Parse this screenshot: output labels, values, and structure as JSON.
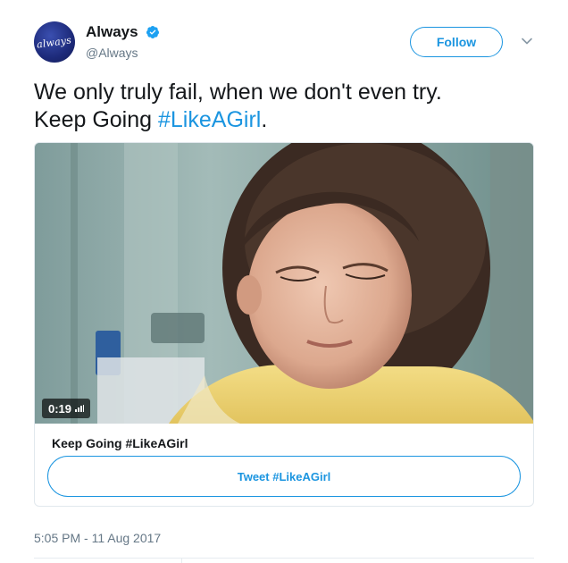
{
  "account": {
    "avatar_text": "always",
    "display_name": "Always",
    "handle": "@Always",
    "verified": true,
    "follow_label": "Follow"
  },
  "tweet": {
    "line1": "We only truly fail, when we don't even try.",
    "line2_prefix": "Keep Going ",
    "hashtag": "#LikeAGirl",
    "line2_suffix": "."
  },
  "card": {
    "duration": "0:19",
    "title": "Keep Going #LikeAGirl",
    "button_label": "Tweet #LikeAGirl"
  },
  "meta": {
    "timestamp": "5:05 PM - 11 Aug 2017"
  },
  "colors": {
    "accent": "#1b95e0",
    "text": "#14171a",
    "secondary": "#657786",
    "border": "#e1e8ed"
  },
  "icons": {
    "verified": "verified-badge-icon",
    "caret": "chevron-down-icon",
    "volume": "volume-bars-icon"
  }
}
